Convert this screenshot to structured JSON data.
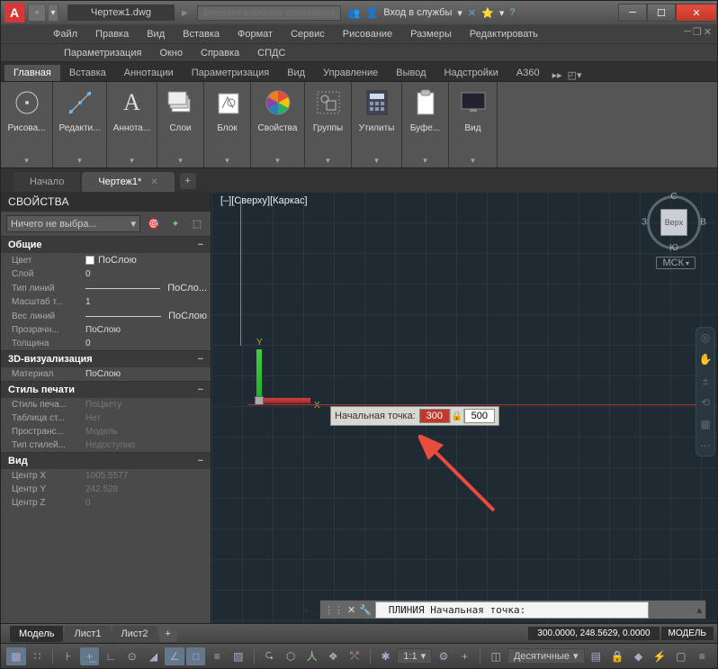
{
  "titlebar": {
    "logo": "A",
    "document": "Чертеж1.dwg",
    "search_placeholder": "Введите ключевое слово/фразу",
    "sign_in": "Вход в службы"
  },
  "menus": {
    "row1": [
      "Файл",
      "Правка",
      "Вид",
      "Вставка",
      "Формат",
      "Сервис",
      "Рисование",
      "Размеры",
      "Редактировать"
    ],
    "row2": [
      "Параметризация",
      "Окно",
      "Справка",
      "СПДС"
    ]
  },
  "ribbon_tabs": [
    "Главная",
    "Вставка",
    "Аннотации",
    "Параметризация",
    "Вид",
    "Управление",
    "Вывод",
    "Надстройки",
    "A360"
  ],
  "panels": [
    {
      "icon": "line",
      "label": "Рисова..."
    },
    {
      "icon": "edit",
      "label": "Редакти..."
    },
    {
      "icon": "A",
      "label": "Аннота..."
    },
    {
      "icon": "layers",
      "label": "Слои"
    },
    {
      "icon": "block",
      "label": "Блок"
    },
    {
      "icon": "colorwheel",
      "label": "Свойства"
    },
    {
      "icon": "group",
      "label": "Группы"
    },
    {
      "icon": "calc",
      "label": "Утилиты"
    },
    {
      "icon": "clip",
      "label": "Буфе..."
    },
    {
      "icon": "monitor",
      "label": "Вид"
    }
  ],
  "doc_tabs": {
    "home": "Начало",
    "active": "Чертеж1*"
  },
  "properties": {
    "title": "СВОЙСТВА",
    "selection": "Ничего не выбра...",
    "sections": {
      "general": {
        "title": "Общие",
        "rows": [
          {
            "k": "Цвет",
            "v": "ПоСлою",
            "swatch": true
          },
          {
            "k": "Слой",
            "v": "0"
          },
          {
            "k": "Тип линий",
            "v": "ПоСло...",
            "line": true
          },
          {
            "k": "Масштаб т...",
            "v": "1"
          },
          {
            "k": "Вес линий",
            "v": "ПоСлою",
            "line": true
          },
          {
            "k": "Прозрачн...",
            "v": "ПоСлою"
          },
          {
            "k": "Толщина",
            "v": "0"
          }
        ]
      },
      "viz3d": {
        "title": "3D-визуализация",
        "rows": [
          {
            "k": "Материал",
            "v": "ПоСлою"
          }
        ]
      },
      "plot": {
        "title": "Стиль печати",
        "rows": [
          {
            "k": "Стиль печа...",
            "v": "ПоЦвету",
            "dim": true
          },
          {
            "k": "Таблица ст...",
            "v": "Нет",
            "dim": true
          },
          {
            "k": "Пространс...",
            "v": "Модель",
            "dim": true
          },
          {
            "k": "Тип стилей...",
            "v": "Недоступно",
            "dim": true
          }
        ]
      },
      "view": {
        "title": "Вид",
        "rows": [
          {
            "k": "Центр X",
            "v": "1005.5577",
            "dim": true
          },
          {
            "k": "Центр Y",
            "v": "242.528",
            "dim": true
          },
          {
            "k": "Центр Z",
            "v": "0",
            "dim": true
          }
        ]
      }
    }
  },
  "canvas": {
    "view_label": "[–][Сверху][Каркас]",
    "dynamic_input": {
      "label": "Начальная точка:",
      "x": "300",
      "y": "500"
    },
    "command": "ПЛИНИЯ Начальная точка:",
    "viewcube": {
      "face": "Верх",
      "n": "С",
      "s": "Ю",
      "e": "В",
      "w": "З",
      "mck": "МСК"
    }
  },
  "bottom": {
    "tabs": [
      "Модель",
      "Лист1",
      "Лист2"
    ],
    "coords": "300.0000, 248.5629, 0.0000",
    "mode": "МОДЕЛЬ"
  },
  "status": {
    "scale": "1:1",
    "units": "Десятичные"
  }
}
